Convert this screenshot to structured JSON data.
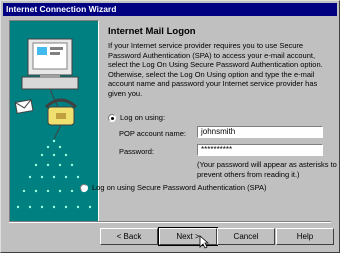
{
  "window": {
    "title": "Internet Connection Wizard"
  },
  "page": {
    "heading": "Internet Mail Logon",
    "intro": "If your Internet service provider requires you to use Secure Password Authentication (SPA) to access your e-mail account, select the Log On Using Secure Password Authentication option. Otherwise, select the Log On Using option and type the e-mail account name and password your Internet service provider has given you."
  },
  "logon": {
    "option_label": "Log on using:",
    "account_label": "POP account name:",
    "account_value": "johnsmith",
    "password_label": "Password:",
    "password_value": "**********",
    "password_note": "(Your password will appear as asterisks to prevent others from reading it.)"
  },
  "spa": {
    "option_label": "Log on using Secure Password Authentication (SPA)"
  },
  "buttons": {
    "back": "< Back",
    "next": "Next >",
    "cancel": "Cancel",
    "help": "Help"
  },
  "colors": {
    "titlebar": "#000080",
    "art_background": "#008080",
    "face": "#c0c0c0"
  }
}
